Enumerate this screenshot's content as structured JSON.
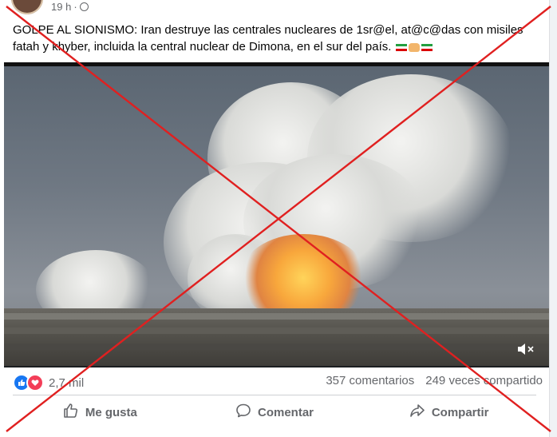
{
  "post": {
    "time": "19 h",
    "separator": "·",
    "text": "GOLPE AL SIONISMO: Iran destruye las centrales nucleares de 1sr@el, at@c@das con misiles fatah y khyber, incluida la central nuclear de Dimona, en el sur del país."
  },
  "stats": {
    "reaction_count": "2,7 mil",
    "comments": "357 comentarios",
    "shares": "249 veces compartido"
  },
  "actions": {
    "like": "Me gusta",
    "comment": "Comentar",
    "share": "Compartir"
  },
  "icons": {
    "like": "thumbs-up-icon",
    "comment": "speech-bubble-icon",
    "share": "share-arrow-icon",
    "privacy": "globe-icon",
    "mute": "speaker-muted-icon"
  },
  "colors": {
    "overlay_cross": "#e02020",
    "like_blue": "#1877f2",
    "love_red": "#f33e58",
    "secondary_text": "#65676b"
  }
}
